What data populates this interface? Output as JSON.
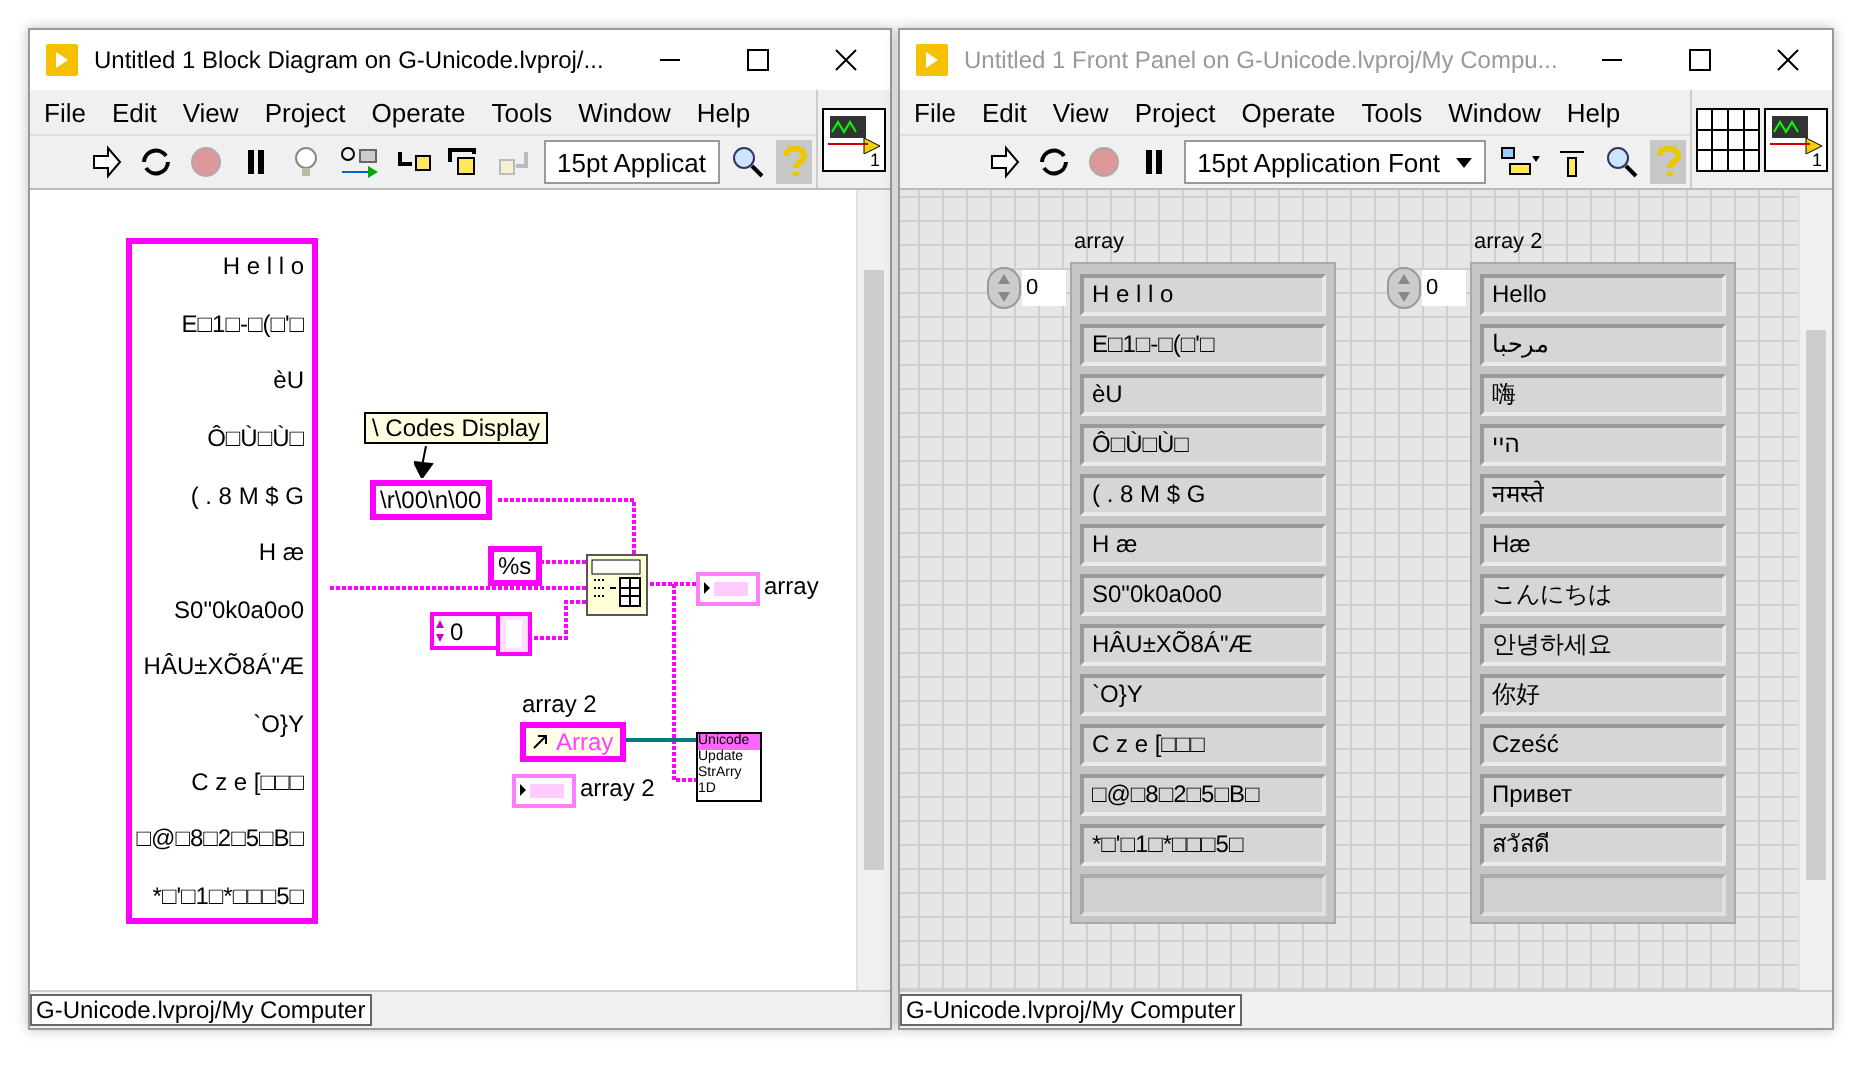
{
  "block_diagram_window": {
    "title": "Untitled 1 Block Diagram on G-Unicode.lvproj/...",
    "active": true,
    "menu": [
      "File",
      "Edit",
      "View",
      "Project",
      "Operate",
      "Tools",
      "Window",
      "Help"
    ],
    "font_select": "15pt Applicat",
    "help_pressed": true,
    "icon_label": "1",
    "diagram": {
      "string_array": [
        "H e l l o",
        "E□1□-□(□'□",
        "èU",
        "Ô□Ù□Ù□",
        "( . 8 M $ G",
        "H æ",
        "S0\"0k0a0o0",
        "HÂU±XÕ8Á\"Æ",
        "`O}Y",
        "C z e [□□□",
        "□@□8□2□5□B□",
        "*□'□1□*□□□5□"
      ],
      "tip_label": "\\ Codes Display",
      "codes_constant": "\\r\\00\\n\\00",
      "format_constant": "%s",
      "index_value": "0",
      "indicator_label": "array",
      "reference_label": "array 2",
      "reference_text": "Array",
      "subvi_lines": [
        "Unicode",
        "Update",
        "StrArry",
        "1D"
      ],
      "indicator2_label": "array 2"
    },
    "status_path": "G-Unicode.lvproj/My Computer"
  },
  "front_panel_window": {
    "title": "Untitled 1 Front Panel on G-Unicode.lvproj/My Compu...",
    "active": false,
    "menu": [
      "File",
      "Edit",
      "View",
      "Project",
      "Operate",
      "Tools",
      "Window",
      "Help"
    ],
    "font_select": "15pt Application Font",
    "help_pressed": true,
    "icon_label": "1",
    "arrays": [
      {
        "label": "array",
        "index": "0",
        "items": [
          "H e l l o",
          "E□1□-□(□'□",
          "èU",
          "Ô□Ù□Ù□",
          "( . 8 M $ G",
          "H æ",
          "S0\"0k0a0o0",
          "HÂU±XÕ8Á\"Æ",
          "`O}Y",
          "C z e [□□□",
          "□@□8□2□5□B□",
          "*□'□1□*□□□5□"
        ]
      },
      {
        "label": "array 2",
        "index": "0",
        "items": [
          "Hello",
          "مرحبا",
          "嗨",
          "היי",
          "नमस्ते",
          "Hæ",
          "こんにちは",
          "안녕하세요",
          "你好",
          "Cześć",
          "Привет",
          "สวัสดี"
        ]
      }
    ],
    "status_path": "G-Unicode.lvproj/My Computer"
  }
}
